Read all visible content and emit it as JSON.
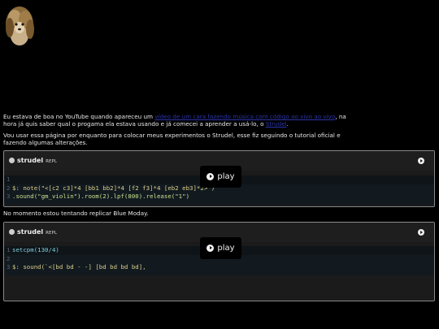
{
  "intro": {
    "before_link": "Eu estava de boa no YouTube quando apareceu um ",
    "link1_text": "vídeo de um cara fazendo música com código ao vivo ao vivo",
    "mid": ", na hora já quis saber qual o progama ela estava usando e já comecei a aprender a usá-lo, o ",
    "link2_text": "Strudel",
    "end": "."
  },
  "usage_text": "Vou usar essa página por enquanto para colocar meus experimentos o Strudel, esse fiz seguindo o tutorial oficial e fazendo algumas alterações.",
  "moment_text": "No momento estou tentando replicar Blue Moday.",
  "repls": [
    {
      "title": "strudel",
      "badge": "REPL",
      "play_label": "play",
      "lines": [
        {
          "n": "1",
          "code": ""
        },
        {
          "n": "2",
          "code": "$: note(\"<[c2 c3]*4 [bb1 bb2]*4 [f2 f3]*4 [eb2 eb3]*2>\")"
        },
        {
          "n": "3",
          "code": ".sound(\"gm_violin\").room(2).lpf(800).release(\"1\")"
        }
      ]
    },
    {
      "title": "strudel",
      "badge": "REPL",
      "play_label": "play",
      "lines": [
        {
          "n": "1",
          "code": "setcpm(130/4)"
        },
        {
          "n": "2",
          "code": ""
        },
        {
          "n": "3",
          "code": "$: sound(`<[bd bd - -] [bd bd bd bd],"
        }
      ]
    }
  ],
  "colors": {
    "background": "#000000",
    "link": "#4c5ce6",
    "panel": "#1b1b1b",
    "code_bg": "#121a20"
  },
  "icons": {
    "avatar": "lion-avatar",
    "repl_logo": "strudel-logo-icon",
    "run": "play-circle-icon"
  }
}
